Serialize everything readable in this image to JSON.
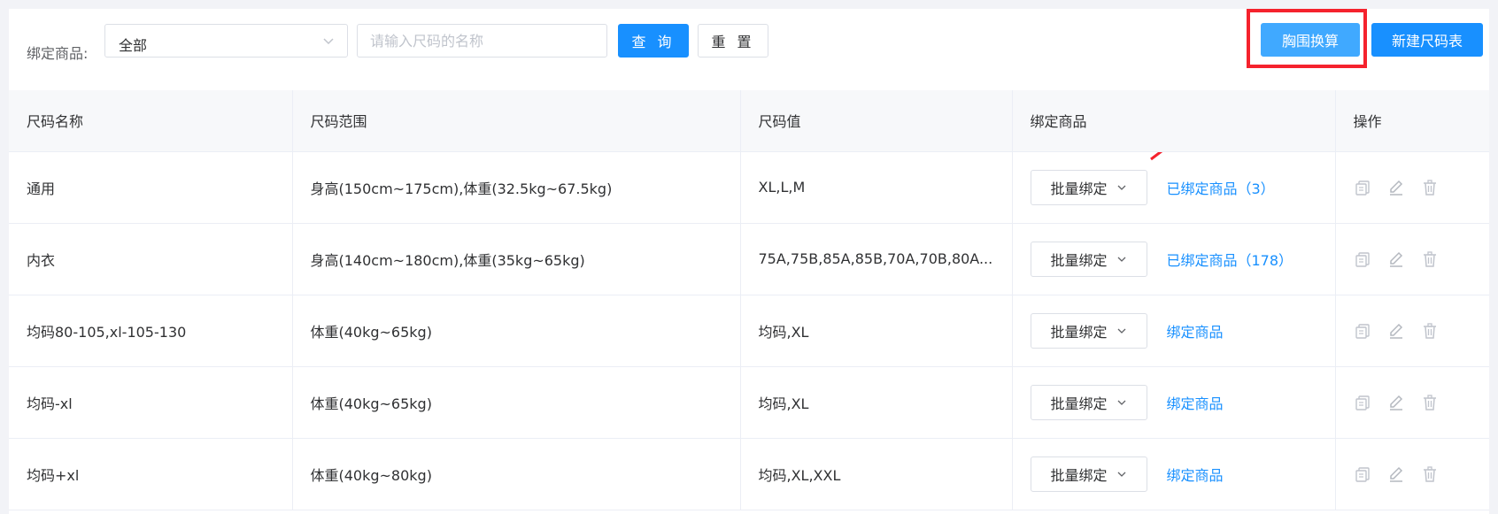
{
  "filter": {
    "label": "绑定商品:",
    "select_value": "全部",
    "search_placeholder": "请输入尺码的名称",
    "query_label": "查 询",
    "reset_label": "重 置"
  },
  "actions": {
    "chest_label": "胸围换算",
    "new_label": "新建尺码表"
  },
  "colors": {
    "primary": "#1890ff",
    "highlight": "#f5222d"
  },
  "table": {
    "headers": [
      "尺码名称",
      "尺码范围",
      "尺码值",
      "绑定商品",
      "操作"
    ],
    "rows": [
      {
        "name": "通用",
        "range": "身高(150cm~175cm),体重(32.5kg~67.5kg)",
        "values": "XL,L,M",
        "bind_button": "批量绑定",
        "bind_link": "已绑定商品（3）"
      },
      {
        "name": "内衣",
        "range": "身高(140cm~180cm),体重(35kg~65kg)",
        "values": "75A,75B,85A,85B,70A,70B,80A...",
        "bind_button": "批量绑定",
        "bind_link": "已绑定商品（178）"
      },
      {
        "name": "均码80-105,xl-105-130",
        "range": "体重(40kg~65kg)",
        "values": "均码,XL",
        "bind_button": "批量绑定",
        "bind_link": "绑定商品"
      },
      {
        "name": "均码-xl",
        "range": "体重(40kg~65kg)",
        "values": "均码,XL",
        "bind_button": "批量绑定",
        "bind_link": "绑定商品"
      },
      {
        "name": "均码+xl",
        "range": "体重(40kg~80kg)",
        "values": "均码,XL,XXL",
        "bind_button": "批量绑定",
        "bind_link": "绑定商品"
      }
    ],
    "row_icons": [
      "copy-icon",
      "edit-icon",
      "delete-icon"
    ]
  }
}
